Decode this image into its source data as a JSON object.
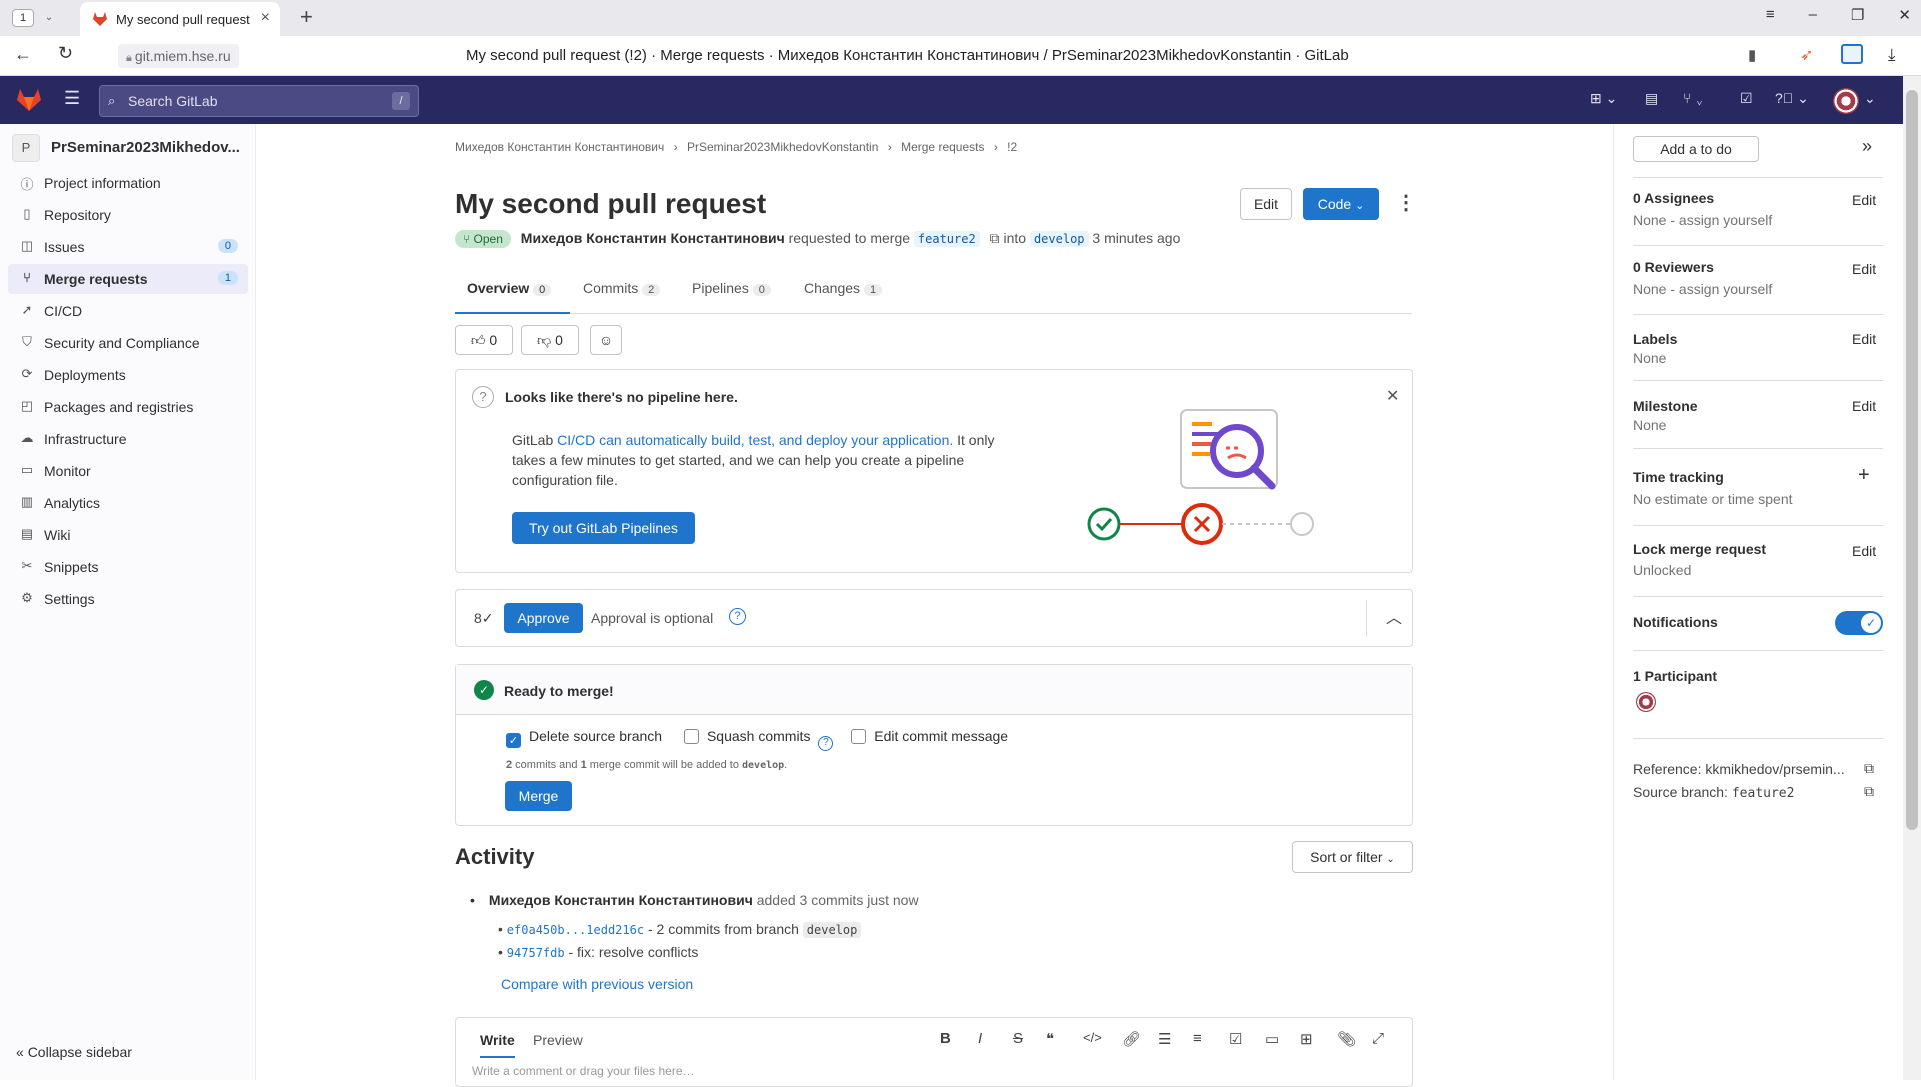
{
  "browser": {
    "tab_count": "1",
    "tab_title": "My second pull request",
    "url": "git.miem.hse.ru",
    "page_title": "My second pull request (!2) · Merge requests · Михедов Константин Константинович / PrSeminar2023MikhedovKonstantin · GitLab"
  },
  "topbar": {
    "search_placeholder": "Search GitLab",
    "search_key": "/"
  },
  "sidebar": {
    "project_initial": "P",
    "project_name": "PrSeminar2023Mikhedov...",
    "items": [
      {
        "label": "Project information",
        "icon": "info-icon"
      },
      {
        "label": "Repository",
        "icon": "repository-icon"
      },
      {
        "label": "Issues",
        "icon": "issues-icon",
        "badge": "0"
      },
      {
        "label": "Merge requests",
        "icon": "merge-request-icon",
        "badge": "1"
      },
      {
        "label": "CI/CD",
        "icon": "rocket-icon"
      },
      {
        "label": "Security and Compliance",
        "icon": "shield-icon"
      },
      {
        "label": "Deployments",
        "icon": "deployments-icon"
      },
      {
        "label": "Packages and registries",
        "icon": "package-icon"
      },
      {
        "label": "Infrastructure",
        "icon": "cloud-icon"
      },
      {
        "label": "Monitor",
        "icon": "monitor-icon"
      },
      {
        "label": "Analytics",
        "icon": "chart-icon"
      },
      {
        "label": "Wiki",
        "icon": "book-icon"
      },
      {
        "label": "Snippets",
        "icon": "scissors-icon"
      },
      {
        "label": "Settings",
        "icon": "gear-icon"
      }
    ],
    "collapse_label": "Collapse sidebar"
  },
  "breadcrumb": {
    "items": [
      "Михедов Константин Константинович",
      "PrSeminar2023MikhedovKonstantin",
      "Merge requests",
      "!2"
    ]
  },
  "mr": {
    "title": "My second pull request",
    "edit_label": "Edit",
    "code_label": "Code",
    "status": "Open",
    "author": "Михедов Константин Константинович",
    "requested_text": "requested to merge",
    "source_branch": "feature2",
    "into_text": "into",
    "target_branch": "develop",
    "time_ago": "3 minutes ago"
  },
  "tabs": [
    {
      "label": "Overview",
      "count": "0"
    },
    {
      "label": "Commits",
      "count": "2"
    },
    {
      "label": "Pipelines",
      "count": "0"
    },
    {
      "label": "Changes",
      "count": "1"
    }
  ],
  "reactions": {
    "thumbs_up": "0",
    "thumbs_down": "0"
  },
  "pipeline_card": {
    "heading": "Looks like there's no pipeline here.",
    "text_pre": "GitLab ",
    "link_text": "CI/CD can automatically build, test, and deploy your application.",
    "text_post": " It only takes a few minutes to get started, and we can help you create a pipeline configuration file.",
    "button": "Try out GitLab Pipelines"
  },
  "approval": {
    "button": "Approve",
    "text": "Approval is optional"
  },
  "merge_widget": {
    "status": "Ready to merge!",
    "delete_branch": "Delete source branch",
    "squash": "Squash commits",
    "edit_msg": "Edit commit message",
    "summary_pre": "2",
    "summary_mid1": " commits and ",
    "summary_num2": "1",
    "summary_mid2": " merge commit will be added to ",
    "summary_branch": "develop",
    "summary_end": ".",
    "merge_button": "Merge"
  },
  "activity": {
    "title": "Activity",
    "sort_label": "Sort or filter",
    "author": "Михедов Константин Константинович",
    "action": "added 3 commits just now",
    "commits": [
      {
        "sha": "ef0a450b...1edd216c",
        "text": " - 2 commits from branch ",
        "branch": "develop"
      },
      {
        "sha": "94757fdb",
        "text": " - fix: resolve conflicts",
        "branch": ""
      }
    ],
    "compare_link": "Compare with previous version"
  },
  "editor": {
    "write_tab": "Write",
    "preview_tab": "Preview",
    "placeholder": "Write a comment or drag your files here…"
  },
  "right_sidebar": {
    "todo": "Add a to do",
    "assignees_title": "0 Assignees",
    "assignees_value": "None - assign yourself",
    "reviewers_title": "0 Reviewers",
    "reviewers_value": "None - assign yourself",
    "labels_title": "Labels",
    "labels_value": "None",
    "milestone_title": "Milestone",
    "milestone_value": "None",
    "time_title": "Time tracking",
    "time_value": "No estimate or time spent",
    "lock_title": "Lock merge request",
    "lock_value": "Unlocked",
    "notifications_title": "Notifications",
    "participants_title": "1 Participant",
    "edit": "Edit",
    "reference": "Reference: kkmikhedov/prsemin...",
    "source_branch_label": "Source branch: ",
    "source_branch_value": "feature2"
  },
  "colors": {
    "brand_bar": "#292961",
    "accent": "#1f75cb",
    "success": "#108548",
    "danger": "#dd2b0e"
  }
}
